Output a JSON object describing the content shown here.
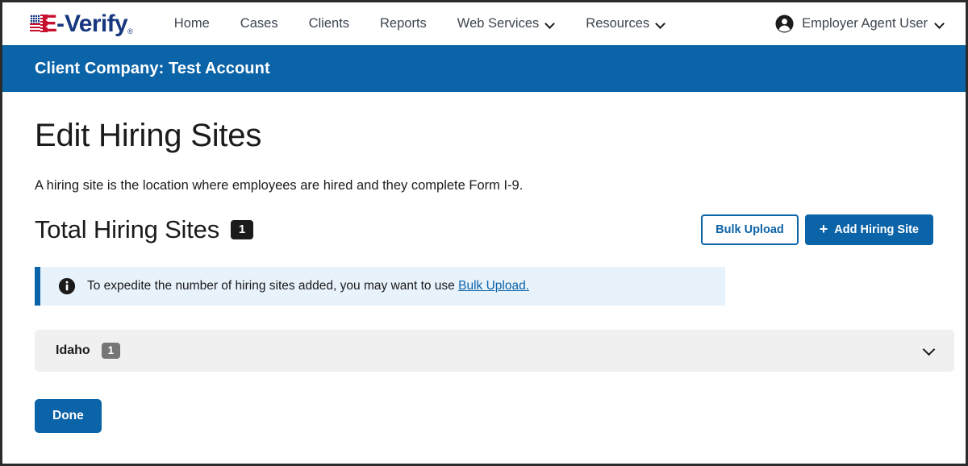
{
  "header": {
    "logo": {
      "e_text": "E",
      "dash": "-",
      "verify_text": "Verify",
      "tm": "®",
      "icon": "us-flag-icon"
    },
    "nav_items": [
      {
        "label": "Home",
        "has_dropdown": false
      },
      {
        "label": "Cases",
        "has_dropdown": false
      },
      {
        "label": "Clients",
        "has_dropdown": false
      },
      {
        "label": "Reports",
        "has_dropdown": false
      },
      {
        "label": "Web Services",
        "has_dropdown": true
      },
      {
        "label": "Resources",
        "has_dropdown": true
      }
    ],
    "user": {
      "name": "Employer Agent User",
      "avatar_icon": "user-circle-icon",
      "caret_icon": "chevron-down-icon"
    }
  },
  "client_banner": {
    "text": "Client Company: Test Account",
    "background_color": "#0b63a8"
  },
  "main": {
    "page_title": "Edit Hiring Sites",
    "description": "A hiring site is the location where employees are hired and they complete Form I-9.",
    "section": {
      "title": "Total Hiring Sites",
      "count": "1"
    },
    "actions": {
      "bulk_upload_label": "Bulk Upload",
      "add_hiring_site_label": "Add Hiring Site",
      "add_icon": "+"
    },
    "alert": {
      "icon": "info-circle-icon",
      "text": "To expedite the number of hiring sites added, you may want to use ",
      "link_text": "Bulk Upload.",
      "background_color": "#e8f2fb",
      "accent_color": "#0b63a8"
    },
    "groups": [
      {
        "label": "Idaho",
        "count": "1",
        "expand_icon": "chevron-down-icon"
      }
    ],
    "done_label": "Done"
  },
  "colors": {
    "brand_blue": "#0b63a8",
    "brand_red": "#c8102e",
    "brand_navy": "#17377e",
    "badge_dark": "#1b1b1b",
    "badge_gray": "#757575"
  }
}
